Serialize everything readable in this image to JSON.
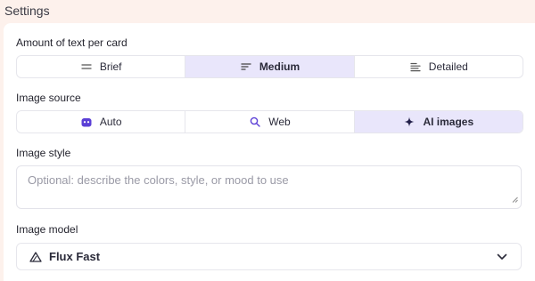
{
  "header": {
    "title": "Settings"
  },
  "text_amount": {
    "label": "Amount of text per card",
    "options": [
      {
        "label": "Brief",
        "icon": "short-text-icon"
      },
      {
        "label": "Medium",
        "icon": "medium-text-icon"
      },
      {
        "label": "Detailed",
        "icon": "detailed-text-icon"
      }
    ],
    "selected": "Medium"
  },
  "image_source": {
    "label": "Image source",
    "options": [
      {
        "label": "Auto",
        "icon": "robot-icon"
      },
      {
        "label": "Web",
        "icon": "search-icon"
      },
      {
        "label": "AI images",
        "icon": "sparkle-icon"
      }
    ],
    "selected": "AI images"
  },
  "image_style": {
    "label": "Image style",
    "placeholder": "Optional: describe the colors, style, or mood to use",
    "value": ""
  },
  "image_model": {
    "label": "Image model",
    "selected": "Flux Fast",
    "icon": "flux-logo-icon"
  },
  "colors": {
    "accent": "#5b3fd6",
    "active_bg": "#e9e6fb",
    "page_bg": "#fdf1ec"
  }
}
